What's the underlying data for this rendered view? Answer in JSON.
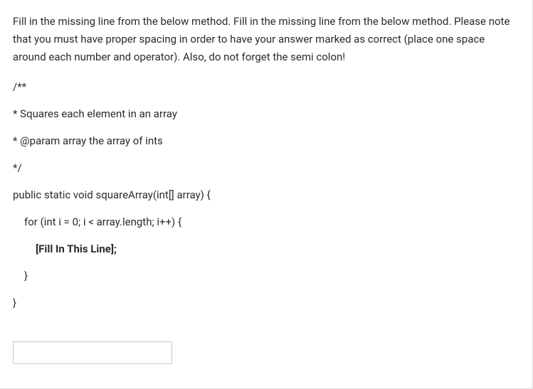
{
  "instruction": "Fill in the missing line from the below method. Fill in the missing line from the below method. Please note that you must have proper spacing in order to have your answer marked as correct (place one space around each number and operator). Also, do not forget the semi colon!",
  "code": {
    "line1": "/**",
    "line2": "* Squares each element in an array",
    "line3": "* @param array the array of ints",
    "line4": "*/",
    "line5": "public static void squareArray(int[] array) {",
    "line6": "for (int i = 0; i < array.length; i++) {",
    "line7": "[Fill In This Line];",
    "line8": "}",
    "line9": "}"
  },
  "input": {
    "value": "",
    "placeholder": ""
  }
}
